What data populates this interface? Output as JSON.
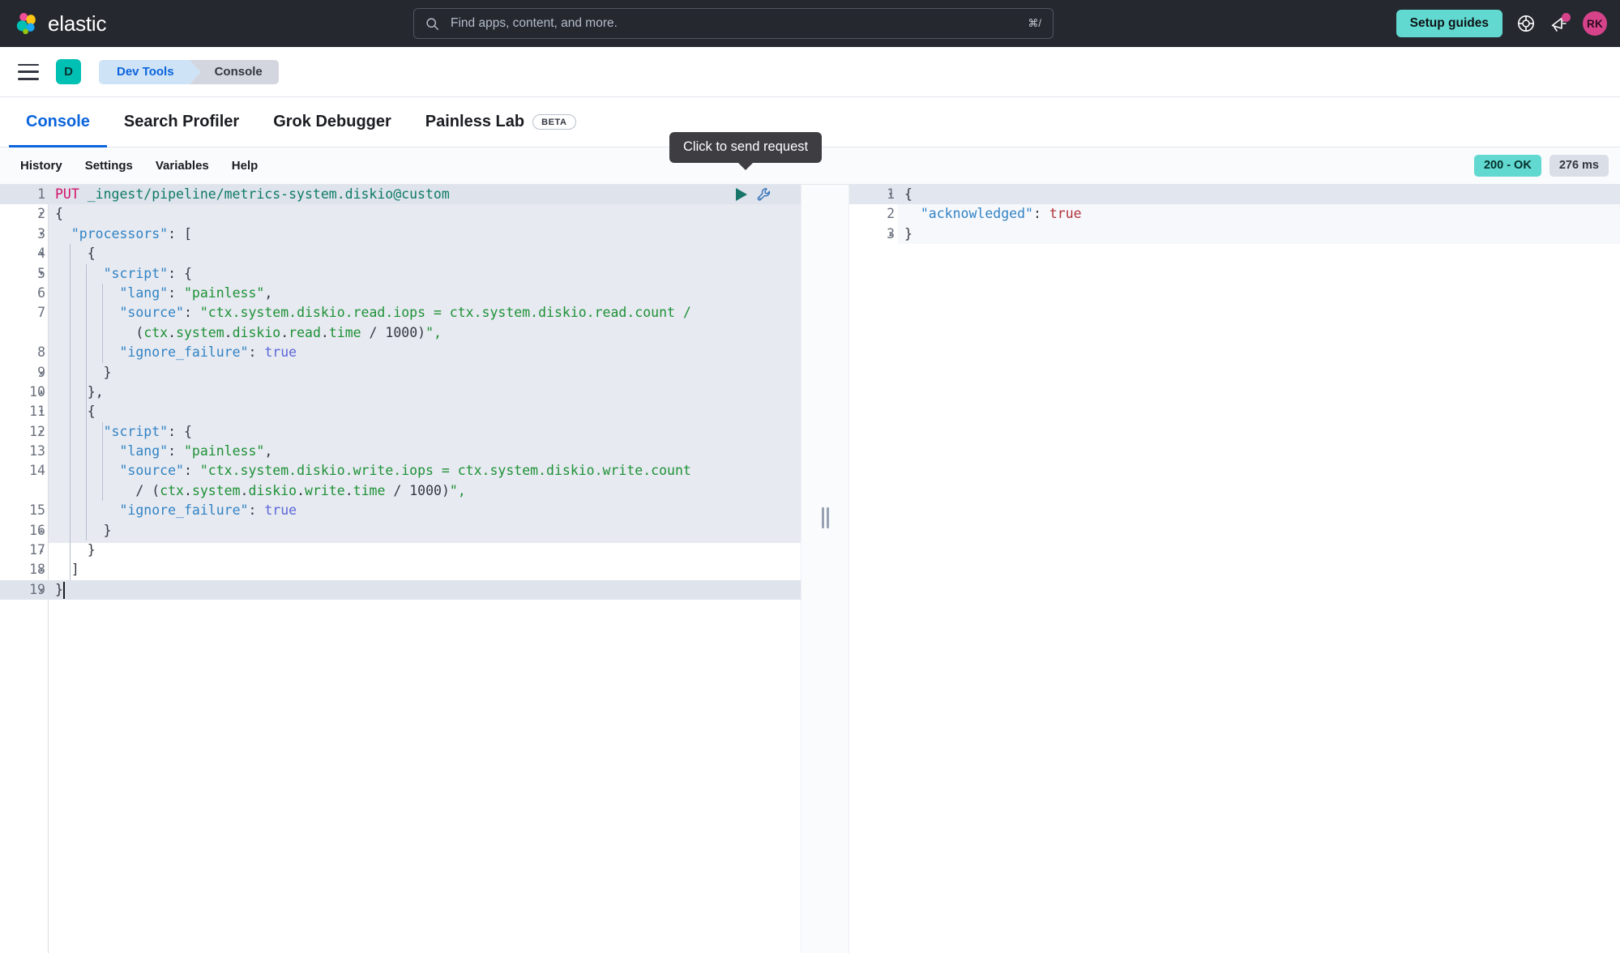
{
  "chrome": {
    "brand_name": "elastic",
    "brand_icon": "elastic-logo-icon",
    "search_placeholder": "Find apps, content, and more.",
    "search_value": "",
    "search_shortcut": "⌘/",
    "search_icon": "search-icon",
    "setup_guides_label": "Setup guides",
    "help_icon": "lifebuoy-help-icon",
    "announcements_icon": "megaphone-announcements-icon",
    "avatar_initials": "RK",
    "accent_teal": "#61d9d0",
    "accent_pink": "#d6438b",
    "bar_background": "#25282f"
  },
  "breadcrumb": {
    "menu_icon": "hamburger-menu-icon",
    "space_initial": "D",
    "items": [
      {
        "label": "Dev Tools"
      },
      {
        "label": "Console"
      }
    ]
  },
  "tabs": [
    {
      "label": "Console",
      "active": true,
      "badge": ""
    },
    {
      "label": "Search Profiler",
      "active": false,
      "badge": ""
    },
    {
      "label": "Grok Debugger",
      "active": false,
      "badge": ""
    },
    {
      "label": "Painless Lab",
      "active": false,
      "badge": "BETA"
    }
  ],
  "console_toolbar": {
    "items": [
      {
        "label": "History"
      },
      {
        "label": "Settings"
      },
      {
        "label": "Variables"
      },
      {
        "label": "Help"
      }
    ],
    "status_code": "200 - OK",
    "response_time": "276 ms"
  },
  "tooltip": {
    "text": "Click to send request"
  },
  "request_editor": {
    "play_icon": "play-send-request-icon",
    "wrench_icon": "wrench-settings-icon",
    "lines": [
      {
        "n": "1",
        "fold": "",
        "active": true,
        "text": "PUT _ingest/pipeline/metrics-system.diskio@custom"
      },
      {
        "n": "2",
        "fold": "▾",
        "active": false,
        "text": "{"
      },
      {
        "n": "3",
        "fold": "▾",
        "active": false,
        "text": "  \"processors\": ["
      },
      {
        "n": "4",
        "fold": "▾",
        "active": false,
        "text": "    {"
      },
      {
        "n": "5",
        "fold": "▾",
        "active": false,
        "text": "      \"script\": {"
      },
      {
        "n": "6",
        "fold": "",
        "active": false,
        "text": "        \"lang\": \"painless\","
      },
      {
        "n": "7",
        "fold": "",
        "active": false,
        "text": "        \"source\": \"ctx.system.diskio.read.iops = ctx.system.diskio.read.count /"
      },
      {
        "n": "",
        "fold": "",
        "active": false,
        "text": "          (ctx.system.diskio.read.time / 1000)\","
      },
      {
        "n": "8",
        "fold": "",
        "active": false,
        "text": "        \"ignore_failure\": true"
      },
      {
        "n": "9",
        "fold": "▴",
        "active": false,
        "text": "      }"
      },
      {
        "n": "10",
        "fold": "▴",
        "active": false,
        "text": "    },"
      },
      {
        "n": "11",
        "fold": "▾",
        "active": false,
        "text": "    {"
      },
      {
        "n": "12",
        "fold": "▾",
        "active": false,
        "text": "      \"script\": {"
      },
      {
        "n": "13",
        "fold": "",
        "active": false,
        "text": "        \"lang\": \"painless\","
      },
      {
        "n": "14",
        "fold": "",
        "active": false,
        "text": "        \"source\": \"ctx.system.diskio.write.iops = ctx.system.diskio.write.count"
      },
      {
        "n": "",
        "fold": "",
        "active": false,
        "text": "          / (ctx.system.diskio.write.time / 1000)\","
      },
      {
        "n": "15",
        "fold": "",
        "active": false,
        "text": "        \"ignore_failure\": true"
      },
      {
        "n": "16",
        "fold": "▴",
        "active": false,
        "text": "      }"
      },
      {
        "n": "17",
        "fold": "▴",
        "active": false,
        "text": "    }"
      },
      {
        "n": "18",
        "fold": "▴",
        "active": false,
        "text": "  ]"
      },
      {
        "n": "19",
        "fold": "▴",
        "active": true,
        "text": "}"
      }
    ]
  },
  "response_editor": {
    "lines": [
      {
        "n": "1",
        "fold": "▾",
        "active": true,
        "text": "{"
      },
      {
        "n": "2",
        "fold": "",
        "active": false,
        "text": "  \"acknowledged\": true"
      },
      {
        "n": "3",
        "fold": "▴",
        "active": false,
        "text": "}"
      }
    ]
  },
  "splitter": {
    "grip_icon": "resize-handle-icon"
  }
}
